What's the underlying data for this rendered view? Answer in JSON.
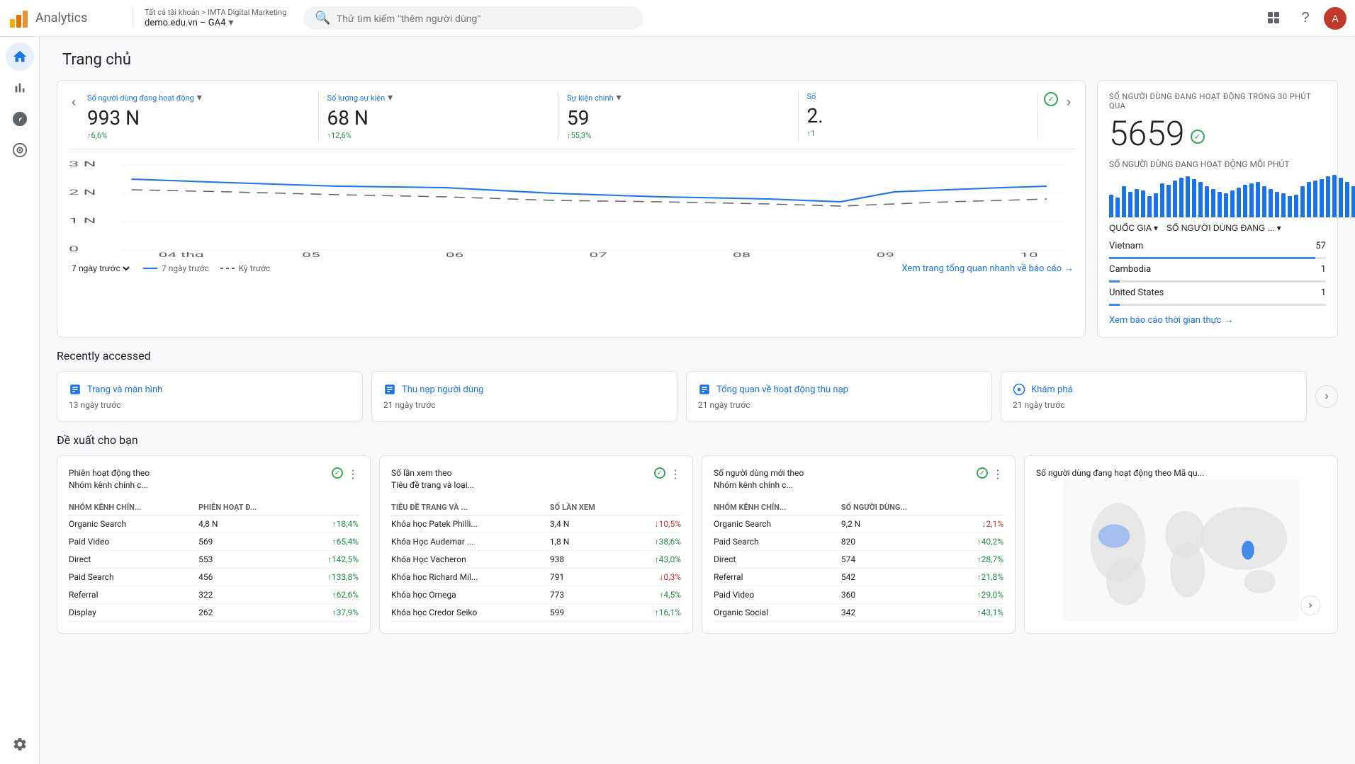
{
  "app": {
    "title": "Analytics",
    "breadcrumb_top": "Tất cả tài khoản > IMTA Digital Marketing",
    "breadcrumb_bottom": "demo.edu.vn – GA4",
    "search_placeholder": "Thử tìm kiếm \"thêm người dùng\""
  },
  "sidebar": {
    "items": [
      {
        "id": "home",
        "icon": "🏠",
        "active": true
      },
      {
        "id": "reports",
        "icon": "📊",
        "active": false
      },
      {
        "id": "explore",
        "icon": "🔍",
        "active": false
      },
      {
        "id": "advertising",
        "icon": "🔗",
        "active": false
      }
    ],
    "bottom": {
      "id": "settings",
      "label": "⚙️"
    }
  },
  "page": {
    "title": "Trang chủ"
  },
  "realtime_overview": {
    "card": {
      "title_label": "SỐ NGƯỜI DÙNG ĐANG HOẠT ĐỘNG TRONG 30 PHÚT QUA",
      "value": "5659",
      "per_minute_label": "SỐ NGƯỜI DÙNG ĐANG HOẠT ĐỘNG MỖI PHÚT",
      "bars": [
        40,
        35,
        55,
        45,
        50,
        48,
        38,
        42,
        60,
        58,
        65,
        70,
        72,
        68,
        62,
        55,
        50,
        45,
        42,
        48,
        52,
        58,
        60,
        62,
        55,
        50,
        45,
        42,
        38,
        40,
        55,
        62,
        65,
        68,
        72,
        75,
        70,
        62,
        55,
        50
      ],
      "filter_country": "QUỐC GIA",
      "filter_users": "SỐ NGƯỜI DÙNG ĐANG ...",
      "countries": [
        {
          "name": "Vietnam",
          "value": "57",
          "pct": 95
        },
        {
          "name": "Cambodia",
          "value": "1",
          "pct": 5
        },
        {
          "name": "United States",
          "value": "1",
          "pct": 5
        }
      ],
      "view_link": "Xem báo cáo thời gian thực"
    }
  },
  "main_chart": {
    "metrics": [
      {
        "label": "Số người dùng đang hoạt động",
        "value": "993 N",
        "change": "↑6,6%",
        "up": true
      },
      {
        "label": "Số lượng sự kiện",
        "value": "68 N",
        "change": "↑12,6%",
        "up": true
      },
      {
        "label": "Sự kiện chính",
        "value": "59",
        "change": "↑55,3%",
        "up": true
      },
      {
        "label": "Số",
        "value": "2.",
        "change": "↑1",
        "up": true
      }
    ],
    "chart_x_labels": [
      "04\nthg",
      "05",
      "06",
      "07",
      "08",
      "09",
      "10"
    ],
    "y_labels": [
      "3 N",
      "2 N",
      "1 N",
      "0"
    ],
    "legend": [
      {
        "label": "7 ngày trước",
        "type": "solid"
      },
      {
        "label": "Kỳ trước",
        "type": "dashed"
      }
    ],
    "period_select": "7 ngày trước",
    "view_report": "Xem trang tổng quan nhanh về báo cáo"
  },
  "recently_accessed": {
    "title": "Recently accessed",
    "items": [
      {
        "icon": "📊",
        "title": "Trang và màn hình",
        "date": "13 ngày trước"
      },
      {
        "icon": "📊",
        "title": "Thu nạp người dùng",
        "date": "21 ngày trước"
      },
      {
        "icon": "📊",
        "title": "Tổng quan về hoạt động thu nạp",
        "date": "21 ngày trước"
      },
      {
        "icon": "🔍",
        "title": "Khám phá",
        "date": "21 ngày trước"
      }
    ]
  },
  "suggestions": {
    "title": "Đề xuất cho bạn",
    "cards": [
      {
        "title": "Phiên hoạt động theo\nNhóm kênh chính c...",
        "col1": "NHÓM KÊNH CHÍN...",
        "col2": "PHIÊN HOẠT Đ...",
        "rows": [
          {
            "label": "Organic Search",
            "value": "4,8 N",
            "change": "↑18,4%",
            "up": true
          },
          {
            "label": "Paid Video",
            "value": "569",
            "change": "↑65,4%",
            "up": true
          },
          {
            "label": "Direct",
            "value": "553",
            "change": "↑142,5%",
            "up": true
          },
          {
            "label": "Paid Search",
            "value": "456",
            "change": "↑133,8%",
            "up": true
          },
          {
            "label": "Referral",
            "value": "322",
            "change": "↑62,6%",
            "up": true
          },
          {
            "label": "Display",
            "value": "262",
            "change": "↑37,9%",
            "up": true
          }
        ]
      },
      {
        "title": "Số lần xem theo\nTiêu đề trang và loại...",
        "col1": "TIÊU ĐỀ TRANG VÀ ...",
        "col2": "SỐ LẦN XEM",
        "rows": [
          {
            "label": "Khóa học Patek Philli...",
            "value": "3,4 N",
            "change": "↓10,5%",
            "up": false
          },
          {
            "label": "Khóa Học Audemar ...",
            "value": "1,8 N",
            "change": "↑38,6%",
            "up": true
          },
          {
            "label": "Khóa Học Vacheron",
            "value": "938",
            "change": "↑43,0%",
            "up": true
          },
          {
            "label": "Khóa học Richard Mil...",
            "value": "791",
            "change": "↓0,3%",
            "up": false
          },
          {
            "label": "Khóa học Omega",
            "value": "773",
            "change": "↑4,5%",
            "up": true
          },
          {
            "label": "Khóa học Credor Seiko",
            "value": "599",
            "change": "↑16,1%",
            "up": true
          }
        ]
      },
      {
        "title": "Số người dùng mới theo\nNhóm kênh chính c...",
        "col1": "NHÓM KÊNH CHÍN...",
        "col2": "SỐ NGƯỜI DÙNG...",
        "rows": [
          {
            "label": "Organic Search",
            "value": "9,2 N",
            "change": "↓2,1%",
            "up": false
          },
          {
            "label": "Paid Search",
            "value": "820",
            "change": "↑40,2%",
            "up": true
          },
          {
            "label": "Direct",
            "value": "574",
            "change": "↑28,7%",
            "up": true
          },
          {
            "label": "Referral",
            "value": "542",
            "change": "↑21,8%",
            "up": true
          },
          {
            "label": "Paid Video",
            "value": "360",
            "change": "↑29,0%",
            "up": true
          },
          {
            "label": "Organic Social",
            "value": "342",
            "change": "↑43,1%",
            "up": true
          }
        ]
      }
    ],
    "map_card_title": "Số người dùng đang hoạt động theo Mã qu..."
  }
}
